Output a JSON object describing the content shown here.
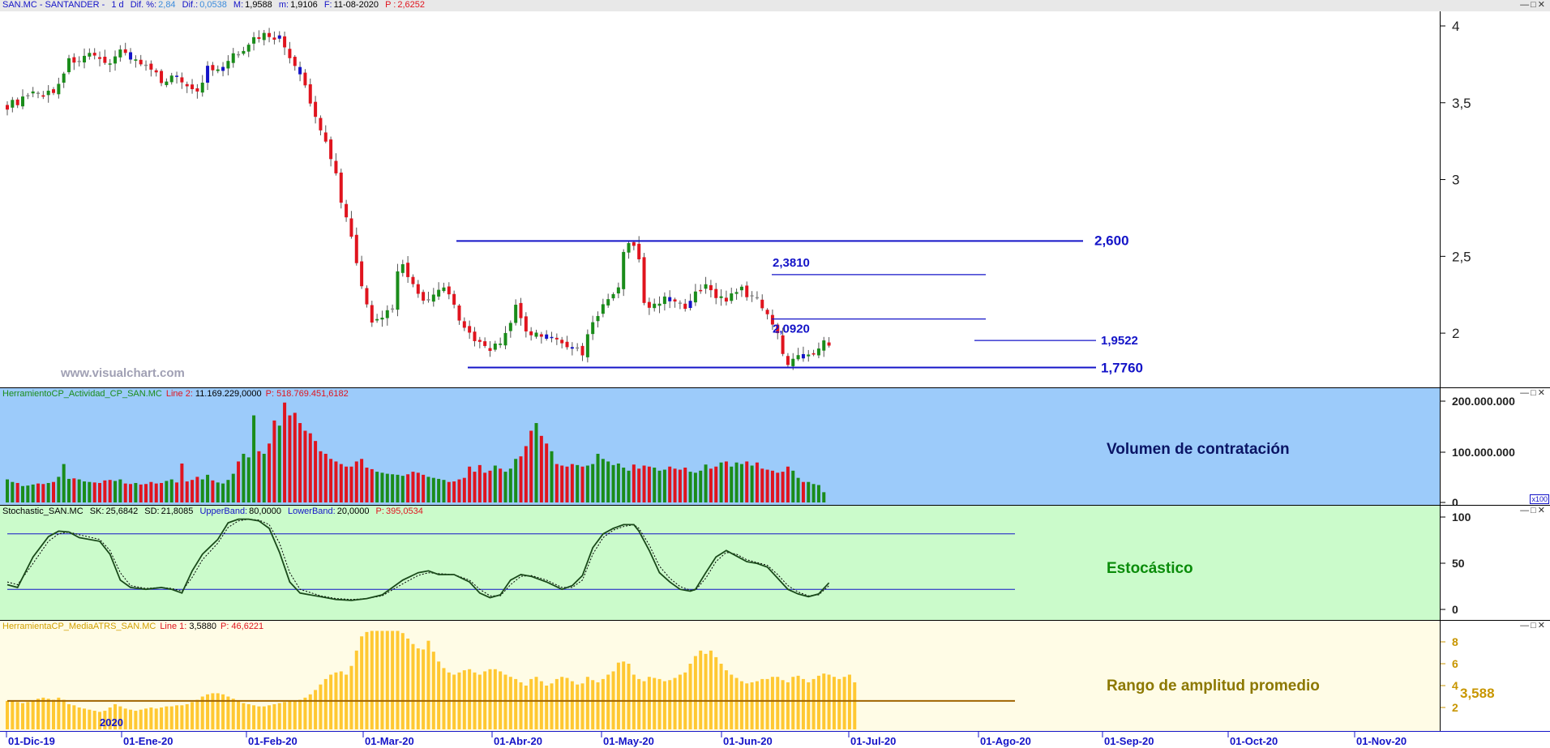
{
  "header": {
    "symbol": "SAN.MC - SANTANDER -",
    "timeframe": "1 d",
    "dif_pct_label": "Dif. %:",
    "dif_pct": "2,84",
    "dif_label": "Dif.:",
    "dif": "0,0538",
    "max_label": "M:",
    "max": "1,9588",
    "min_label": "m:",
    "min": "1,9106",
    "date_label": "F:",
    "date": "11-08-2020",
    "price_label": "P :",
    "price": "2,6252"
  },
  "watermark": "www.visualchart.com",
  "colors": {
    "up": "#1a8c1a",
    "down": "#e0141e",
    "doji": "#1414c8",
    "level": "#1414c8"
  },
  "chart_data": [
    {
      "type": "candlestick",
      "title": "SAN.MC - SANTANDER - 1 d",
      "ylim": [
        1.7,
        4.05
      ],
      "y_ticks": [
        "4",
        "3,5",
        "3",
        "2,5",
        "2"
      ],
      "x_ticks": [
        "01-Dic-19",
        "01-Ene-20",
        "01-Feb-20",
        "01-Mar-20",
        "01-Abr-20",
        "01-May-20",
        "01-Jun-20",
        "01-Jul-20",
        "01-Ago-20",
        "01-Sep-20",
        "01-Oct-20",
        "01-Nov-20"
      ],
      "year_marker": "2020",
      "close_path": [
        [
          0,
          3.48
        ],
        [
          5,
          3.55
        ],
        [
          9,
          3.57
        ],
        [
          12,
          3.77
        ],
        [
          16,
          3.8
        ],
        [
          19,
          3.75
        ],
        [
          22,
          3.84
        ],
        [
          25,
          3.78
        ],
        [
          28,
          3.7
        ],
        [
          30,
          3.65
        ],
        [
          33,
          3.67
        ],
        [
          36,
          3.6
        ],
        [
          37,
          3.56
        ],
        [
          39,
          3.72
        ],
        [
          41,
          3.7
        ],
        [
          44,
          3.8
        ],
        [
          47,
          3.89
        ],
        [
          50,
          3.95
        ],
        [
          53,
          3.92
        ],
        [
          56,
          3.74
        ],
        [
          58,
          3.6
        ],
        [
          60,
          3.4
        ],
        [
          62,
          3.25
        ],
        [
          64,
          3.05
        ],
        [
          65,
          2.85
        ],
        [
          67,
          2.65
        ],
        [
          69,
          2.3
        ],
        [
          71,
          2.05
        ],
        [
          73,
          2.12
        ],
        [
          75,
          2.14
        ],
        [
          76,
          2.38
        ],
        [
          77,
          2.45
        ],
        [
          79,
          2.3
        ],
        [
          82,
          2.2
        ],
        [
          85,
          2.3
        ],
        [
          88,
          2.1
        ],
        [
          91,
          1.95
        ],
        [
          94,
          1.9
        ],
        [
          96,
          1.95
        ],
        [
          98,
          2.05
        ],
        [
          99,
          2.18
        ],
        [
          101,
          2.0
        ],
        [
          104,
          1.98
        ],
        [
          107,
          1.95
        ],
        [
          110,
          1.9
        ],
        [
          112,
          1.88
        ],
        [
          114,
          2.08
        ],
        [
          116,
          2.17
        ],
        [
          119,
          2.28
        ],
        [
          120,
          2.55
        ],
        [
          122,
          2.58
        ],
        [
          123,
          2.47
        ],
        [
          124,
          2.2
        ],
        [
          126,
          2.17
        ],
        [
          128,
          2.25
        ],
        [
          130,
          2.2
        ],
        [
          132,
          2.15
        ],
        [
          134,
          2.25
        ],
        [
          136,
          2.3
        ],
        [
          138,
          2.25
        ],
        [
          140,
          2.22
        ],
        [
          143,
          2.28
        ],
        [
          146,
          2.21
        ],
        [
          148,
          2.14
        ],
        [
          150,
          2.0
        ],
        [
          151,
          1.85
        ],
        [
          152,
          1.81
        ],
        [
          154,
          1.88
        ],
        [
          156,
          1.84
        ],
        [
          158,
          1.91
        ],
        [
          159,
          1.94
        ]
      ],
      "levels": [
        {
          "label": "2,600",
          "value": 2.6
        },
        {
          "label": "2,3810",
          "value": 2.381
        },
        {
          "label": "2,0920",
          "value": 2.092
        },
        {
          "label": "1,9522",
          "value": 1.9522
        },
        {
          "label": "1,7760",
          "value": 1.776
        }
      ]
    },
    {
      "type": "bar",
      "title": "HerramientoCP_Actividad_CP_SAN.MC",
      "ylim": [
        0,
        200000000
      ],
      "y_ticks": [
        "200.000.000",
        "100.000.000",
        "0"
      ],
      "scale_note": "x100",
      "values": [
        45,
        40,
        38,
        32,
        33,
        35,
        37,
        36,
        38,
        40,
        50,
        75,
        46,
        47,
        45,
        41,
        40,
        39,
        38,
        43,
        44,
        42,
        45,
        37,
        36,
        38,
        35,
        36,
        40,
        37,
        38,
        42,
        45,
        39,
        76,
        41,
        44,
        50,
        45,
        54,
        43,
        39,
        37,
        44,
        56,
        80,
        95,
        88,
        170,
        100,
        95,
        115,
        160,
        150,
        195,
        170,
        175,
        155,
        140,
        135,
        120,
        100,
        95,
        85,
        80,
        75,
        70,
        70,
        80,
        85,
        68,
        65,
        60,
        58,
        56,
        55,
        54,
        52,
        55,
        60,
        58,
        54,
        50,
        48,
        46,
        44,
        40,
        41,
        45,
        48,
        70,
        60,
        73,
        58,
        62,
        72,
        66,
        60,
        66,
        85,
        90,
        110,
        140,
        155,
        130,
        115,
        100,
        75,
        72,
        70,
        75,
        73,
        70,
        72,
        75,
        95,
        85,
        80,
        73,
        76,
        68,
        62,
        74,
        66,
        72,
        70,
        68,
        62,
        64,
        70,
        66,
        64,
        68,
        60,
        58,
        62,
        74,
        66,
        70,
        78,
        80,
        70,
        78,
        75,
        80,
        72,
        78,
        66,
        64,
        62,
        58,
        60,
        70,
        62,
        48,
        40,
        40,
        36,
        34,
        20
      ],
      "label": "Volumen de contratación",
      "legend": {
        "series": "Line 2:",
        "series_value": "11.169.229,0000",
        "p_label": "P:",
        "p_value": "518.769.451,6182"
      }
    },
    {
      "type": "line",
      "title": "Stochastic_SAN.MC",
      "ylim": [
        0,
        100
      ],
      "y_ticks": [
        "100",
        "50",
        "0"
      ],
      "upper_band": 80,
      "lower_band": 20,
      "sk_path": [
        [
          0,
          25
        ],
        [
          2,
          22
        ],
        [
          5,
          55
        ],
        [
          8,
          77
        ],
        [
          10,
          83
        ],
        [
          12,
          82
        ],
        [
          14,
          76
        ],
        [
          18,
          72
        ],
        [
          20,
          58
        ],
        [
          22,
          30
        ],
        [
          24,
          22
        ],
        [
          27,
          20
        ],
        [
          30,
          22
        ],
        [
          32,
          20
        ],
        [
          34,
          16
        ],
        [
          36,
          40
        ],
        [
          38,
          58
        ],
        [
          41,
          74
        ],
        [
          43,
          92
        ],
        [
          45,
          96
        ],
        [
          47,
          96
        ],
        [
          49,
          94
        ],
        [
          51,
          86
        ],
        [
          53,
          60
        ],
        [
          55,
          28
        ],
        [
          57,
          16
        ],
        [
          61,
          12
        ],
        [
          64,
          9
        ],
        [
          67,
          8
        ],
        [
          70,
          10
        ],
        [
          73,
          14
        ],
        [
          77,
          30
        ],
        [
          80,
          38
        ],
        [
          82,
          40
        ],
        [
          84,
          36
        ],
        [
          87,
          36
        ],
        [
          90,
          28
        ],
        [
          92,
          16
        ],
        [
          94,
          11
        ],
        [
          96,
          14
        ],
        [
          98,
          30
        ],
        [
          100,
          36
        ],
        [
          102,
          34
        ],
        [
          105,
          28
        ],
        [
          108,
          20
        ],
        [
          110,
          24
        ],
        [
          112,
          35
        ],
        [
          114,
          65
        ],
        [
          116,
          80
        ],
        [
          118,
          86
        ],
        [
          120,
          90
        ],
        [
          122,
          90
        ],
        [
          123,
          83
        ],
        [
          125,
          62
        ],
        [
          127,
          38
        ],
        [
          129,
          28
        ],
        [
          131,
          20
        ],
        [
          133,
          18
        ],
        [
          134,
          20
        ],
        [
          136,
          38
        ],
        [
          138,
          55
        ],
        [
          140,
          62
        ],
        [
          142,
          56
        ],
        [
          144,
          50
        ],
        [
          146,
          48
        ],
        [
          148,
          44
        ],
        [
          150,
          32
        ],
        [
          152,
          20
        ],
        [
          154,
          15
        ],
        [
          156,
          12
        ],
        [
          158,
          15
        ],
        [
          160,
          27
        ]
      ],
      "sd_path": [
        [
          0,
          28
        ],
        [
          2,
          25
        ],
        [
          5,
          48
        ],
        [
          8,
          72
        ],
        [
          10,
          80
        ],
        [
          12,
          82
        ],
        [
          14,
          79
        ],
        [
          18,
          74
        ],
        [
          20,
          62
        ],
        [
          22,
          38
        ],
        [
          24,
          24
        ],
        [
          27,
          21
        ],
        [
          30,
          22
        ],
        [
          32,
          21
        ],
        [
          34,
          18
        ],
        [
          36,
          33
        ],
        [
          38,
          52
        ],
        [
          41,
          70
        ],
        [
          43,
          87
        ],
        [
          45,
          94
        ],
        [
          47,
          96
        ],
        [
          49,
          95
        ],
        [
          51,
          90
        ],
        [
          53,
          70
        ],
        [
          55,
          38
        ],
        [
          57,
          20
        ],
        [
          61,
          13
        ],
        [
          64,
          10
        ],
        [
          67,
          9
        ],
        [
          70,
          10
        ],
        [
          73,
          13
        ],
        [
          77,
          26
        ],
        [
          80,
          35
        ],
        [
          82,
          38
        ],
        [
          84,
          37
        ],
        [
          87,
          36
        ],
        [
          90,
          30
        ],
        [
          92,
          20
        ],
        [
          94,
          13
        ],
        [
          96,
          13
        ],
        [
          98,
          25
        ],
        [
          100,
          34
        ],
        [
          102,
          35
        ],
        [
          105,
          30
        ],
        [
          108,
          22
        ],
        [
          110,
          22
        ],
        [
          112,
          30
        ],
        [
          114,
          58
        ],
        [
          116,
          76
        ],
        [
          118,
          84
        ],
        [
          120,
          88
        ],
        [
          122,
          90
        ],
        [
          123,
          86
        ],
        [
          125,
          68
        ],
        [
          127,
          45
        ],
        [
          129,
          32
        ],
        [
          131,
          23
        ],
        [
          133,
          19
        ],
        [
          134,
          19
        ],
        [
          136,
          32
        ],
        [
          138,
          50
        ],
        [
          140,
          60
        ],
        [
          142,
          58
        ],
        [
          144,
          52
        ],
        [
          146,
          49
        ],
        [
          148,
          46
        ],
        [
          150,
          36
        ],
        [
          152,
          24
        ],
        [
          154,
          17
        ],
        [
          156,
          13
        ],
        [
          158,
          14
        ],
        [
          160,
          24
        ]
      ],
      "label": "Estocástico",
      "legend": {
        "sk_label": "SK:",
        "sk": "25,6842",
        "sd_label": "SD:",
        "sd": "21,8085",
        "upper_label": "UpperBand:",
        "upper": "80,0000",
        "lower_label": "LowerBand:",
        "lower": "20,0000",
        "p_label": "P:",
        "p_value": "395,0534"
      }
    },
    {
      "type": "bar",
      "title": "HerramientaCP_MediaATRS_SAN.MC",
      "ylim": [
        0,
        9
      ],
      "y_ticks": [
        "8",
        "6",
        "4",
        "2"
      ],
      "values": [
        2.6,
        2.6,
        2.5,
        2.4,
        2.5,
        2.6,
        2.8,
        2.9,
        2.8,
        2.7,
        2.9,
        2.7,
        2.3,
        2.2,
        2.0,
        1.9,
        1.8,
        1.7,
        1.6,
        1.7,
        2.0,
        2.3,
        2.1,
        1.9,
        1.8,
        1.7,
        1.8,
        1.9,
        2.0,
        1.9,
        2.0,
        2.1,
        2.1,
        2.2,
        2.2,
        2.3,
        2.5,
        2.7,
        3.0,
        3.2,
        3.3,
        3.3,
        3.2,
        3.0,
        2.8,
        2.6,
        2.4,
        2.3,
        2.2,
        2.1,
        2.1,
        2.2,
        2.3,
        2.4,
        2.5,
        2.6,
        2.6,
        2.7,
        2.9,
        3.2,
        3.6,
        4.1,
        4.6,
        5.0,
        5.2,
        5.3,
        5.0,
        5.8,
        7.2,
        8.5,
        8.9,
        9.0,
        9.0,
        9.0,
        9.0,
        9.0,
        9.0,
        8.8,
        8.3,
        7.8,
        7.4,
        7.3,
        8.1,
        7.1,
        6.2,
        5.6,
        5.2,
        5.0,
        5.2,
        5.4,
        5.5,
        5.2,
        5.0,
        5.3,
        5.5,
        5.5,
        5.3,
        5.0,
        4.8,
        4.6,
        4.3,
        4.0,
        4.6,
        4.8,
        4.4,
        4.0,
        4.2,
        4.6,
        4.8,
        4.7,
        4.4,
        4.1,
        4.2,
        4.8,
        4.5,
        4.3,
        4.6,
        5.0,
        5.3,
        6.1,
        6.2,
        6.0,
        5.0,
        4.6,
        4.4,
        4.8,
        4.7,
        4.6,
        4.4,
        4.5,
        4.7,
        5.0,
        5.2,
        6.0,
        6.7,
        7.2,
        6.9,
        7.2,
        6.6,
        6.0,
        5.4,
        5.0,
        4.7,
        4.4,
        4.2,
        4.3,
        4.4,
        4.6,
        4.6,
        4.8,
        4.8,
        4.5,
        4.3,
        4.8,
        4.9,
        4.6,
        4.3,
        4.6,
        4.9,
        5.1,
        5.0,
        4.8,
        4.6,
        4.8,
        5.0,
        4.3
      ],
      "mean_line": 2.6,
      "value_label": "3,588",
      "label": "Rango de amplitud promedio",
      "legend": {
        "series": "Line 1:",
        "series_value": "3,5880",
        "p_label": "P:",
        "p_value": "46,6221"
      }
    }
  ]
}
